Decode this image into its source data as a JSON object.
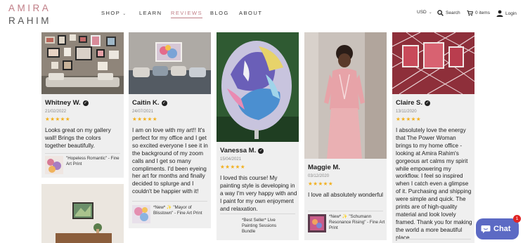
{
  "header": {
    "logo_line1": "AMIRA",
    "logo_line2": "RAHIM",
    "nav": {
      "shop": "SHOP",
      "learn": "LEARN",
      "reviews": "REVIEWS",
      "blog": "BLOG",
      "about": "ABOUT"
    },
    "currency": "USD",
    "search": "Search",
    "cart": "0 items",
    "login": "Login"
  },
  "reviews": [
    {
      "name": "Whitney W.",
      "date": "21/02/2022",
      "stars": "★★★★★",
      "body": "Looks great on my gallery wall! Brings the colors together beautifully.",
      "product": "\"Hopeless Romantic\" - Fine Art Print"
    },
    {
      "name": "Caitin K.",
      "date": "24/07/2021",
      "stars": "★★★★★",
      "body": "I am on love with my art!! It's perfect for my office and I get so excited everyone I see it in the background of my zoom calls and I get so many compliments.  I'd been eyeing her art for months and finally decided to splurge and I couldn't be happier with it!",
      "product": "*New* ✨ \"Mayor of Blisstown\" - Fine Art Print"
    },
    {
      "name": "Vanessa M.",
      "date": "15/04/2021",
      "stars": "★★★★★",
      "body": "I loved this course! My painting style is developing in a way I'm very happy with and I paint for my own enjoyment and relaxation.",
      "product": "*Best Seller* Live Painting Sessions Bundle"
    },
    {
      "name": "Maggie M.",
      "date": "03/12/2020",
      "stars": "★★★★★",
      "body": "I love all absolutely wonderful",
      "product": "*New* ✨ \"Schumann Resonance Rising\" - Fine Art Print"
    },
    {
      "name": "Claire S.",
      "date": "13/11/2020",
      "stars": "★★★★★",
      "body": "I absolutely love the energy that The Power Woman brings to my home office - looking at Amira Rahim's gorgeous art calms my spirit while empowering my workflow. I feel so inspired when I catch even a glimpse of it. Purchasing and shipping were simple and quick. The prints are of high-quality material and look lovely framed. Thank you for making the world a more beautiful place."
    }
  ],
  "chat": {
    "label": "Chat",
    "badge": "1"
  }
}
